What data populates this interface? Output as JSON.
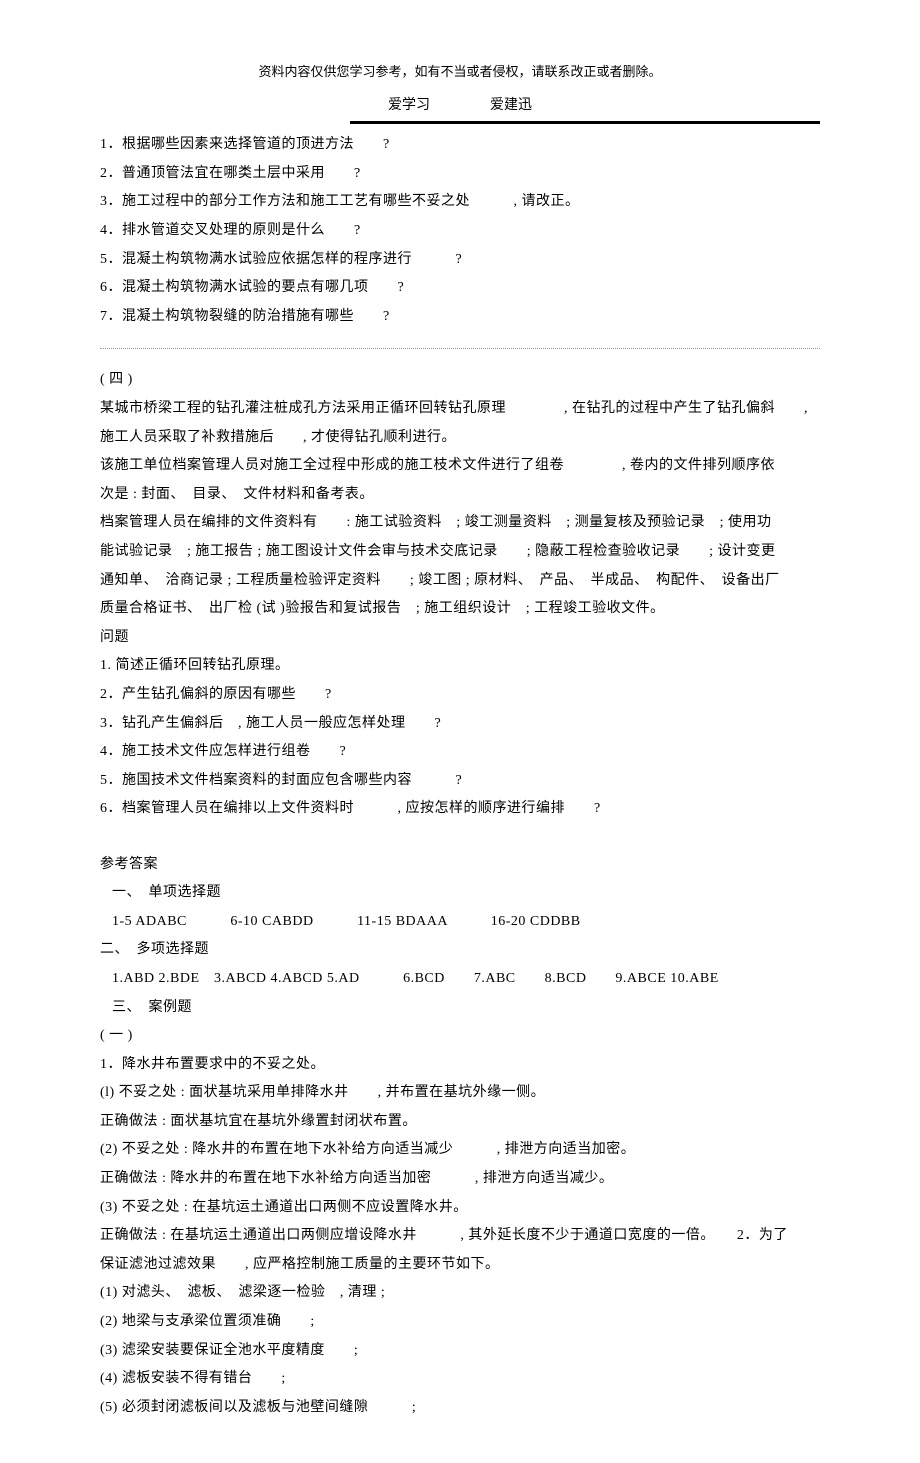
{
  "disclaimer": "资料内容仅供您学习参考，如有不当或者侵权，请联系改正或者删除。",
  "header": {
    "title1": "爱学习",
    "title2": "爱建迅"
  },
  "block1": {
    "lines": [
      "1．根据哪些因素来选择管道的顶进方法　　?",
      "2．普通顶管法宜在哪类土层中采用　　?",
      "3．施工过程中的部分工作方法和施工工艺有哪些不妥之处　　　, 请改正。",
      "4．排水管道交叉处理的原则是什么　　?",
      "5．混凝土构筑物满水试验应依据怎样的程序进行　　　?",
      "6．混凝土构筑物满水试验的要点有哪几项　　?",
      "7．混凝土构筑物裂缝的防治措施有哪些　　?"
    ]
  },
  "block2": {
    "heading": "( 四 )",
    "paragraphs": [
      "某城市桥梁工程的钻孔灌注桩成孔方法采用正循环回转钻孔原理　　　　, 在钻孔的过程中产生了钻孔偏斜　　,",
      "施工人员采取了补救措施后　　, 才使得钻孔顺利进行。",
      "该施工单位档案管理人员对施工全过程中形成的施工枝术文件进行了组卷　　　　, 卷内的文件排列顺序依",
      "次是 : 封面、　目录、　文件材料和备考表。",
      "档案管理人员在编排的文件资料有　　: 施工试验资料　; 竣工测量资料　; 测量复核及预验记录　; 使用功",
      "能试验记录　; 施工报告 ; 施工图设计文件会审与技术交底记录　　; 隐蔽工程检查验收记录　　; 设计变更",
      "通知单、　洽商记录 ; 工程质量检验评定资料　　; 竣工图 ; 原材料、　产品、　半成品、　构配件、　设备出厂",
      "质量合格证书、　出厂检 (试 )验报告和复试报告　; 施工组织设计　; 工程竣工验收文件。"
    ],
    "questionHeading": "问题",
    "questions": [
      "1. 简述正循环回转钻孔原理。",
      "2．产生钻孔偏斜的原因有哪些　　?",
      "3．钻孔产生偏斜后　, 施工人员一般应怎样处理　　?",
      "4．施工技术文件应怎样进行组卷　　?",
      "5．施国技术文件档案资料的封面应包含哪些内容　　　?",
      "6．档案管理人员在编排以上文件资料时　　　, 应按怎样的顺序进行编排　　?"
    ]
  },
  "answers": {
    "heading": "参考答案",
    "section1": {
      "title": "一、　单项选择题",
      "content": "1-5 ADABC　　　6-10 CABDD　　　11-15 BDAAA　　　16-20 CDDBB"
    },
    "section2": {
      "title": "二、　多项选择题",
      "content": "1.ABD  2.BDE　3.ABCD  4.ABCD  5.AD　　　6.BCD　　7.ABC　　8.BCD　　9.ABCE  10.ABE"
    },
    "section3": {
      "title": "三、　案例题",
      "subheading": "( 一 )",
      "lines": [
        "1．降水井布置要求中的不妥之处。",
        "(l) 不妥之处 : 面状基坑采用单排降水井　　, 并布置在基坑外缘一侧。",
        "正确做法 : 面状基坑宜在基坑外缘置封闭状布置。",
        "(2) 不妥之处 : 降水井的布置在地下水补给方向适当减少　　　, 排泄方向适当加密。",
        "正确做法 : 降水井的布置在地下水补给方向适当加密　　　, 排泄方向适当减少。",
        "(3) 不妥之处 : 在基坑运土通道出口两侧不应设置降水井。",
        "正确做法 : 在基坑运土通道出口两侧应增设降水井　　　, 其外延长度不少于通道口宽度的一倍。　　2．为了",
        "保证滤池过滤效果　　, 应严格控制施工质量的主要环节如下。",
        "(1) 对滤头、　滤板、　滤梁逐一检验　, 清理 ;",
        "(2) 地梁与支承梁位置须准确　　;",
        "(3) 滤梁安装要保证全池水平度精度　　;",
        "(4) 滤板安装不得有错台　　;",
        "(5) 必须封闭滤板间以及滤板与池壁间缝隙　　　;"
      ]
    }
  }
}
